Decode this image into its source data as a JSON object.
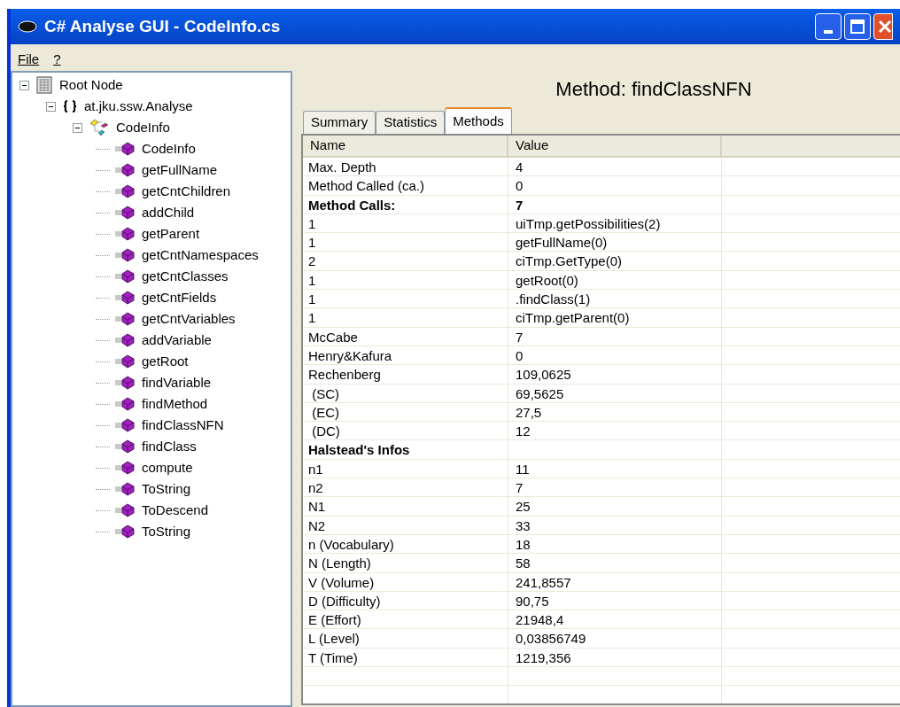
{
  "window": {
    "title": "C# Analyse GUI - CodeInfo.cs"
  },
  "menu": [
    "File",
    "?"
  ],
  "tree": [
    {
      "label": "Root Node",
      "kind": "root",
      "expanded": true,
      "children": [
        {
          "label": "at.jku.ssw.Analyse",
          "kind": "namespace",
          "expanded": true,
          "children": [
            {
              "label": "CodeInfo",
              "kind": "class",
              "expanded": true,
              "children": [
                {
                  "label": "CodeInfo",
                  "kind": "method"
                },
                {
                  "label": "getFullName",
                  "kind": "method"
                },
                {
                  "label": "getCntChildren",
                  "kind": "method"
                },
                {
                  "label": "addChild",
                  "kind": "method"
                },
                {
                  "label": "getParent",
                  "kind": "method"
                },
                {
                  "label": "getCntNamespaces",
                  "kind": "method"
                },
                {
                  "label": "getCntClasses",
                  "kind": "method"
                },
                {
                  "label": "getCntFields",
                  "kind": "method"
                },
                {
                  "label": "getCntVariables",
                  "kind": "method"
                },
                {
                  "label": "addVariable",
                  "kind": "method"
                },
                {
                  "label": "getRoot",
                  "kind": "method"
                },
                {
                  "label": "findVariable",
                  "kind": "method"
                },
                {
                  "label": "findMethod",
                  "kind": "method"
                },
                {
                  "label": "findClassNFN",
                  "kind": "method"
                },
                {
                  "label": "findClass",
                  "kind": "method"
                },
                {
                  "label": "compute",
                  "kind": "method"
                },
                {
                  "label": "ToString",
                  "kind": "method"
                },
                {
                  "label": "ToDescend",
                  "kind": "method"
                },
                {
                  "label": "ToString",
                  "kind": "method"
                }
              ]
            }
          ]
        }
      ]
    }
  ],
  "heading": "Method: findClassNFN",
  "tabs": [
    {
      "label": "Summary",
      "selected": false
    },
    {
      "label": "Statistics",
      "selected": false
    },
    {
      "label": "Methods",
      "selected": true
    }
  ],
  "table": {
    "columns": [
      "Name",
      "Value"
    ],
    "rows": [
      {
        "name": "Max. Depth",
        "value": "4",
        "bold": false
      },
      {
        "name": "Method Called (ca.)",
        "value": "0",
        "bold": false
      },
      {
        "name": "Method Calls:",
        "value": "7",
        "bold": true
      },
      {
        "name": "1",
        "value": "uiTmp.getPossibilities(2)",
        "bold": false
      },
      {
        "name": "1",
        "value": "getFullName(0)",
        "bold": false
      },
      {
        "name": "2",
        "value": "ciTmp.GetType(0)",
        "bold": false
      },
      {
        "name": "1",
        "value": "getRoot(0)",
        "bold": false
      },
      {
        "name": "1",
        "value": ".findClass(1)",
        "bold": false
      },
      {
        "name": "1",
        "value": "ciTmp.getParent(0)",
        "bold": false
      },
      {
        "name": "McCabe",
        "value": "7",
        "bold": false
      },
      {
        "name": "Henry&Kafura",
        "value": "0",
        "bold": false
      },
      {
        "name": "Rechenberg",
        "value": "109,0625",
        "bold": false
      },
      {
        "name": " (SC)",
        "value": "69,5625",
        "bold": false
      },
      {
        "name": " (EC)",
        "value": "27,5",
        "bold": false
      },
      {
        "name": " (DC)",
        "value": "12",
        "bold": false
      },
      {
        "name": "Halstead's Infos",
        "bold": true
      },
      {
        "name": "n1",
        "value": "11",
        "bold": false
      },
      {
        "name": "n2",
        "value": "7",
        "bold": false
      },
      {
        "name": "N1",
        "value": "25",
        "bold": false
      },
      {
        "name": "N2",
        "value": "33",
        "bold": false
      },
      {
        "name": "n (Vocabulary)",
        "value": "18",
        "bold": false
      },
      {
        "name": "N (Length)",
        "value": "58",
        "bold": false
      },
      {
        "name": "V (Volume)",
        "value": "241,8557",
        "bold": false
      },
      {
        "name": "D (Difficulty)",
        "value": "90,75",
        "bold": false
      },
      {
        "name": "E (Effort)",
        "value": "21948,4",
        "bold": false
      },
      {
        "name": "L (Level)",
        "value": "0,03856749",
        "bold": false
      },
      {
        "name": "T (Time)",
        "value": "1219,356",
        "bold": false
      }
    ]
  }
}
